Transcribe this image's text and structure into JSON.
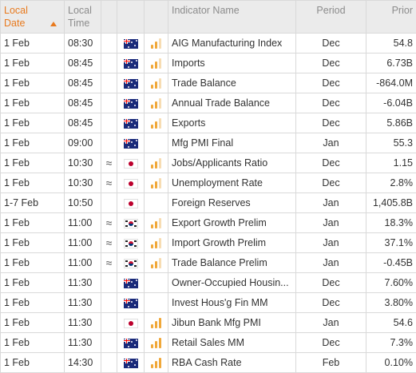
{
  "header": {
    "local_date": "Local Date",
    "local_time": "Local Time",
    "indicator_name": "Indicator Name",
    "period": "Period",
    "prior": "Prior"
  },
  "colors": {
    "accent": "#e87a1e",
    "importance_on": "#f0a83a",
    "importance_off": "#f7dcb2"
  },
  "rows": [
    {
      "date": "1 Feb",
      "time": "08:30",
      "approx": "",
      "country": "australia-flag",
      "importance": 2,
      "name": "AIG Manufacturing Index",
      "period": "Dec",
      "prior": "54.8"
    },
    {
      "date": "1 Feb",
      "time": "08:45",
      "approx": "",
      "country": "australia-flag",
      "importance": 2,
      "name": "Imports",
      "period": "Dec",
      "prior": "6.73B"
    },
    {
      "date": "1 Feb",
      "time": "08:45",
      "approx": "",
      "country": "australia-flag",
      "importance": 2,
      "name": "Trade Balance",
      "period": "Dec",
      "prior": "-864.0M"
    },
    {
      "date": "1 Feb",
      "time": "08:45",
      "approx": "",
      "country": "australia-flag",
      "importance": 2,
      "name": "Annual Trade Balance",
      "period": "Dec",
      "prior": "-6.04B"
    },
    {
      "date": "1 Feb",
      "time": "08:45",
      "approx": "",
      "country": "australia-flag",
      "importance": 2,
      "name": "Exports",
      "period": "Dec",
      "prior": "5.86B"
    },
    {
      "date": "1 Feb",
      "time": "09:00",
      "approx": "",
      "country": "australia-flag",
      "importance": 0,
      "name": "Mfg PMI Final",
      "period": "Jan",
      "prior": "55.3"
    },
    {
      "date": "1 Feb",
      "time": "10:30",
      "approx": "≈",
      "country": "japan-flag",
      "importance": 2,
      "name": "Jobs/Applicants Ratio",
      "period": "Dec",
      "prior": "1.15"
    },
    {
      "date": "1 Feb",
      "time": "10:30",
      "approx": "≈",
      "country": "japan-flag",
      "importance": 2,
      "name": "Unemployment Rate",
      "period": "Dec",
      "prior": "2.8%"
    },
    {
      "date": "1-7 Feb",
      "time": "10:50",
      "approx": "",
      "country": "japan-flag",
      "importance": 0,
      "name": "Foreign Reserves",
      "period": "Jan",
      "prior": "1,405.8B"
    },
    {
      "date": "1 Feb",
      "time": "11:00",
      "approx": "≈",
      "country": "korea-flag",
      "importance": 2,
      "name": "Export Growth Prelim",
      "period": "Jan",
      "prior": "18.3%"
    },
    {
      "date": "1 Feb",
      "time": "11:00",
      "approx": "≈",
      "country": "korea-flag",
      "importance": 2,
      "name": "Import Growth Prelim",
      "period": "Jan",
      "prior": "37.1%"
    },
    {
      "date": "1 Feb",
      "time": "11:00",
      "approx": "≈",
      "country": "korea-flag",
      "importance": 2,
      "name": "Trade Balance Prelim",
      "period": "Jan",
      "prior": "-0.45B"
    },
    {
      "date": "1 Feb",
      "time": "11:30",
      "approx": "",
      "country": "australia-flag",
      "importance": 0,
      "name": "Owner-Occupied Housin...",
      "period": "Dec",
      "prior": "7.60%"
    },
    {
      "date": "1 Feb",
      "time": "11:30",
      "approx": "",
      "country": "australia-flag",
      "importance": 0,
      "name": "Invest Hous'g Fin MM",
      "period": "Dec",
      "prior": "3.80%"
    },
    {
      "date": "1 Feb",
      "time": "11:30",
      "approx": "",
      "country": "japan-flag",
      "importance": 3,
      "name": "Jibun Bank Mfg PMI",
      "period": "Jan",
      "prior": "54.6"
    },
    {
      "date": "1 Feb",
      "time": "11:30",
      "approx": "",
      "country": "australia-flag",
      "importance": 3,
      "name": "Retail Sales MM",
      "period": "Dec",
      "prior": "7.3%"
    },
    {
      "date": "1 Feb",
      "time": "14:30",
      "approx": "",
      "country": "australia-flag",
      "importance": 3,
      "name": "RBA Cash Rate",
      "period": "Feb",
      "prior": "0.10%"
    }
  ]
}
